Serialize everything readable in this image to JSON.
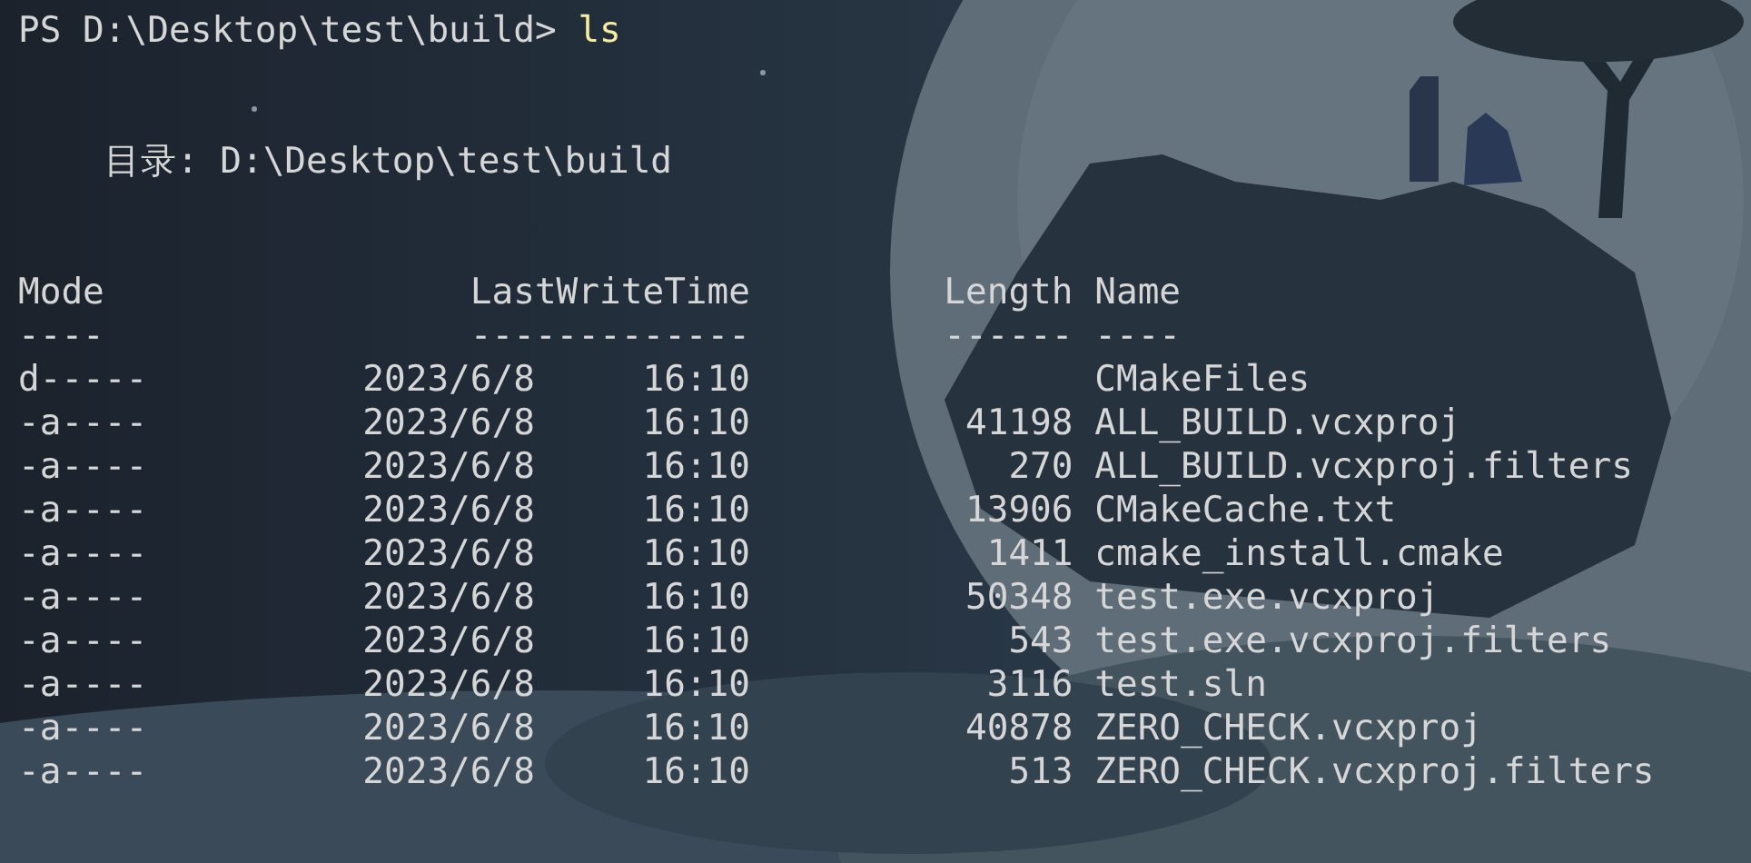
{
  "prompt": {
    "text": "PS D:\\Desktop\\test\\build> ",
    "command": "ls"
  },
  "directory": "目录: D:\\Desktop\\test\\build",
  "columns": [
    {
      "label": "Mode",
      "rule": "----"
    },
    {
      "label": "LastWriteTime",
      "rule": "-------------"
    },
    {
      "label": "Length",
      "rule": "------"
    },
    {
      "label": "Name",
      "rule": "----"
    }
  ],
  "rows": [
    {
      "mode": "d-----",
      "date": "2023/6/8",
      "time": "16:10",
      "name": "CMakeFiles"
    },
    {
      "mode": "-a----",
      "date": "2023/6/8",
      "time": "16:10",
      "length": "41198",
      "name": "ALL_BUILD.vcxproj"
    },
    {
      "mode": "-a----",
      "date": "2023/6/8",
      "time": "16:10",
      "length": "270",
      "name": "ALL_BUILD.vcxproj.filters"
    },
    {
      "mode": "-a----",
      "date": "2023/6/8",
      "time": "16:10",
      "length": "13906",
      "name": "CMakeCache.txt"
    },
    {
      "mode": "-a----",
      "date": "2023/6/8",
      "time": "16:10",
      "length": "1411",
      "name": "cmake_install.cmake"
    },
    {
      "mode": "-a----",
      "date": "2023/6/8",
      "time": "16:10",
      "length": "50348",
      "name": "test.exe.vcxproj"
    },
    {
      "mode": "-a----",
      "date": "2023/6/8",
      "time": "16:10",
      "length": "543",
      "name": "test.exe.vcxproj.filters"
    },
    {
      "mode": "-a----",
      "date": "2023/6/8",
      "time": "16:10",
      "length": "3116",
      "name": "test.sln"
    },
    {
      "mode": "-a----",
      "date": "2023/6/8",
      "time": "16:10",
      "length": "40878",
      "name": "ZERO_CHECK.vcxproj"
    },
    {
      "mode": "-a----",
      "date": "2023/6/8",
      "time": "16:10",
      "length": "513",
      "name": "ZERO_CHECK.vcxproj.filters"
    }
  ]
}
